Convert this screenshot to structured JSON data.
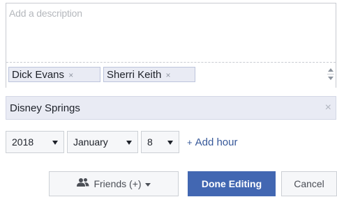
{
  "description": {
    "placeholder": "Add a description"
  },
  "tags": [
    {
      "label": "Dick Evans",
      "remove": "×"
    },
    {
      "label": "Sherri Keith",
      "remove": "×"
    }
  ],
  "location": {
    "value": "Disney Springs",
    "clear": "×"
  },
  "date": {
    "year": "2018",
    "month": "January",
    "day": "8"
  },
  "add_hour": {
    "icon": "+",
    "label": "Add hour"
  },
  "footer": {
    "audience_label": "Friends (+)",
    "done_label": "Done Editing",
    "cancel_label": "Cancel"
  },
  "colors": {
    "primary": "#4267b2",
    "link": "#365899",
    "tag_bg": "#e9ebf4"
  }
}
